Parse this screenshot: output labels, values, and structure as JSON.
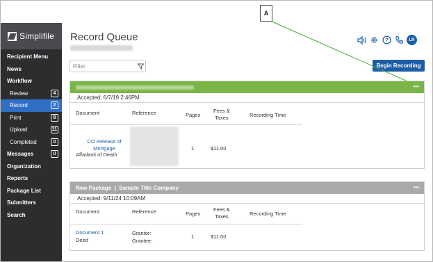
{
  "callout": {
    "label": "A"
  },
  "sidebar": {
    "brand": "Simplifile",
    "items": [
      {
        "label": "Recipient Menu",
        "sub": false,
        "badge": ""
      },
      {
        "label": "News",
        "sub": false,
        "badge": ""
      },
      {
        "label": "Workflow",
        "sub": false,
        "badge": ""
      },
      {
        "label": "Review",
        "sub": true,
        "badge": "4"
      },
      {
        "label": "Record",
        "sub": true,
        "badge": "2",
        "active": true
      },
      {
        "label": "Print",
        "sub": true,
        "badge": "8"
      },
      {
        "label": "Upload",
        "sub": true,
        "badge": "11"
      },
      {
        "label": "Completed",
        "sub": true,
        "badge": "0"
      },
      {
        "label": "Messages",
        "sub": false,
        "badge": "0"
      },
      {
        "label": "Organization",
        "sub": false,
        "badge": ""
      },
      {
        "label": "Reports",
        "sub": false,
        "badge": ""
      },
      {
        "label": "Package List",
        "sub": false,
        "badge": ""
      },
      {
        "label": "Submitters",
        "sub": false,
        "badge": ""
      },
      {
        "label": "Search",
        "sub": false,
        "badge": ""
      }
    ]
  },
  "header": {
    "title": "Record Queue",
    "icons": [
      "speaker-icon",
      "gear-icon",
      "help-icon",
      "phone-icon"
    ],
    "avatar": "LR",
    "accent": "#1d5da8"
  },
  "filter": {
    "placeholder": "Filter"
  },
  "begin_button": "Begin Recording",
  "columns": {
    "document": "Document",
    "reference": "Reference",
    "pages": "Pages",
    "fees": "Fees &\nTaxes",
    "recording_time": "Recording Time"
  },
  "packages": [
    {
      "header_color": "#7ab547",
      "title": "",
      "accepted": "Accepted: 6/7/19 2:46PM",
      "rows": [
        {
          "doc_title": "CO Release of\nMortgage",
          "doc_subtitle": "Affadavit of Death",
          "reference": "",
          "pages": "1",
          "fees": "$11.00"
        }
      ]
    },
    {
      "header_color": "#a9a9a9",
      "title": "New Package  |  Sample Title Company",
      "accepted": "Accepted: 9/11/24 10:09AM",
      "rows": [
        {
          "doc_title": "Document 1",
          "doc_subtitle": "Deed",
          "reference": "Grantor:\nGrantee:",
          "pages": "1",
          "fees": "$11.00"
        }
      ]
    }
  ]
}
